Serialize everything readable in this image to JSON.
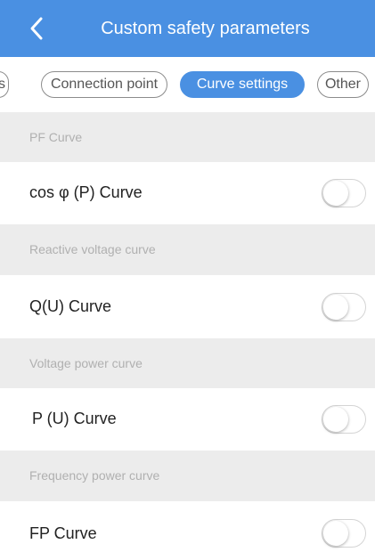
{
  "header": {
    "title": "Custom safety parameters"
  },
  "tabs": [
    {
      "label": "s",
      "active": false
    },
    {
      "label": "Connection point",
      "active": false
    },
    {
      "label": "Curve settings",
      "active": true
    },
    {
      "label": "Other",
      "active": false
    }
  ],
  "sections": [
    {
      "header": "PF Curve",
      "row_label": "cos φ (P) Curve",
      "toggle_on": false
    },
    {
      "header": "Reactive voltage curve",
      "row_label": "Q(U) Curve",
      "toggle_on": false
    },
    {
      "header": "Voltage power curve",
      "row_label": "P (U) Curve",
      "toggle_on": false
    },
    {
      "header": "Frequency  power curve",
      "row_label": "FP Curve",
      "toggle_on": false
    }
  ],
  "colors": {
    "accent": "#4a90e2",
    "section_bg": "#ececec",
    "section_text": "#b0b0b0"
  }
}
